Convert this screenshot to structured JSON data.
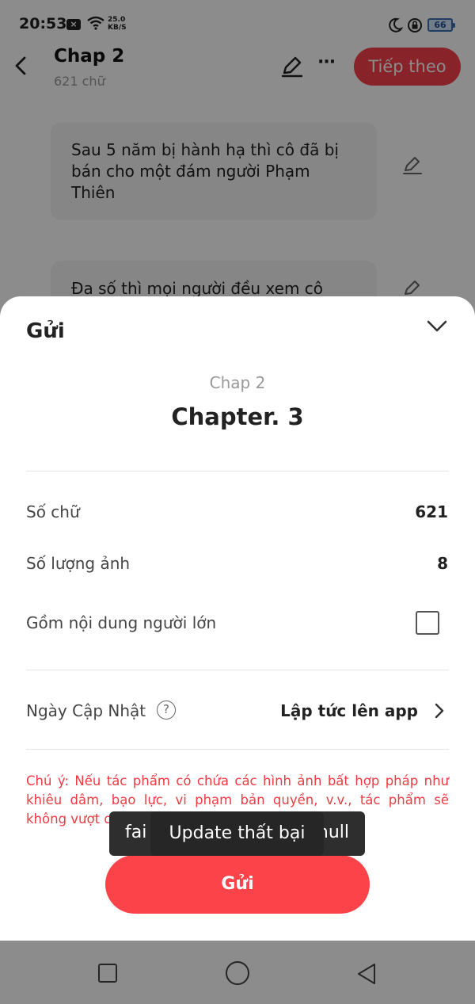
{
  "status_bar": {
    "time": "20:53",
    "notification_badge": "x-box-icon",
    "net_speed_value": "25.0",
    "net_speed_unit": "KB/S",
    "battery_level": "66"
  },
  "header": {
    "title": "Chap 2",
    "subtitle": "621 chữ",
    "next_button": "Tiếp theo"
  },
  "content": {
    "paragraphs": [
      "Sau 5 năm bị hành hạ thì  cô đã bị bán cho một đám người Phạm Thiên",
      "Đa số thì mọi người đều xem cô"
    ]
  },
  "sheet": {
    "title": "Gửi",
    "chap_label": "Chap 2",
    "chapter_name": "Chapter. 3",
    "rows": [
      {
        "label": "Số chữ",
        "value": "621"
      },
      {
        "label": "Số lượng ảnh",
        "value": "8"
      },
      {
        "label": "Gồm nội dung người lớn",
        "checked": false
      }
    ],
    "update_date": {
      "label": "Ngày Cập Nhật",
      "help": "?",
      "value": "Lập tức lên app"
    },
    "notice": "Chú ý: Nếu tác phẩm có chứa các hình ảnh bất hợp pháp như khiêu dâm, bạo lực, vi phạm bản quyền, v.v., tác phẩm sẽ không vượt qua vòng xét duyệt",
    "send_button": "Gửi"
  },
  "toasts": {
    "back_left": "fai",
    "back_right": "null",
    "front": "Update thất bại"
  },
  "colors": {
    "accent": "#f6414b",
    "notice_text": "#ee3b42",
    "battery": "#3a6fb5"
  }
}
